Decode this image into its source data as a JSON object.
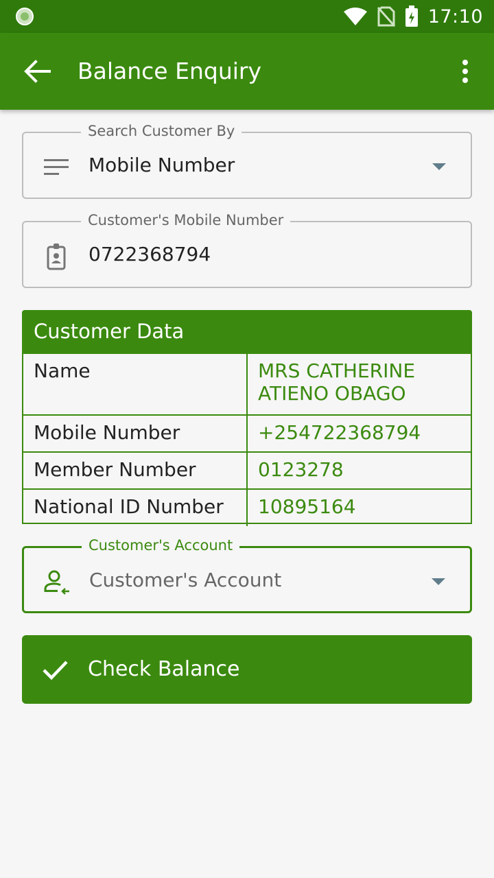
{
  "status_bar": {
    "time": "17:10"
  },
  "app_bar": {
    "title": "Balance Enquiry"
  },
  "search_by": {
    "label": "Search Customer By",
    "value": "Mobile Number"
  },
  "mobile_field": {
    "label": "Customer's Mobile Number",
    "value": "0722368794"
  },
  "customer_data": {
    "title": "Customer Data",
    "rows": [
      {
        "key": "Name",
        "value": "MRS CATHERINE ATIENO OBAGO"
      },
      {
        "key": "Mobile Number",
        "value": "+254722368794"
      },
      {
        "key": "Member Number",
        "value": "0123278"
      },
      {
        "key": "National ID Number",
        "value": "10895164"
      }
    ]
  },
  "account_field": {
    "label": "Customer's Account",
    "placeholder": "Customer's Account"
  },
  "check_balance": {
    "label": "Check Balance"
  },
  "colors": {
    "primary": "#3b8a0f",
    "status_bar": "#2f7a0b",
    "background": "#f6f6f6"
  }
}
